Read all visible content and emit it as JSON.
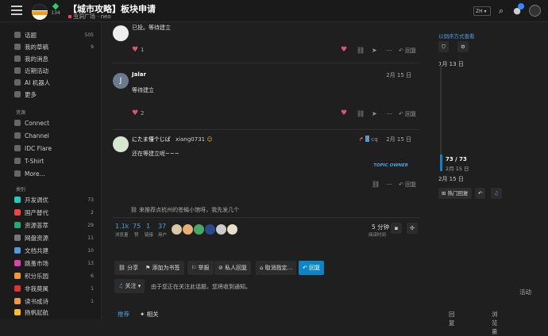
{
  "header": {
    "title": "【城市攻略】板块申请",
    "level": "134",
    "breadcrumb": [
      "虫洞广场",
      "neo"
    ],
    "lang": "ZH"
  },
  "sidebar": {
    "items": [
      {
        "label": "话题",
        "count": "505"
      },
      {
        "label": "我的草稿",
        "count": "9"
      },
      {
        "label": "我的消息",
        "count": ""
      },
      {
        "label": "近期活动",
        "count": ""
      },
      {
        "label": "AI 机器人",
        "count": ""
      },
      {
        "label": "更多",
        "count": ""
      }
    ],
    "resources_head": "资源",
    "resources": [
      "Connect",
      "Channel",
      "IDC Flare",
      "T-Shirt",
      "More..."
    ],
    "categories_head": "类别",
    "categories": [
      {
        "label": "开发调优",
        "count": "73"
      },
      {
        "label": "国产替代",
        "count": "2"
      },
      {
        "label": "资源荟萃",
        "count": "29"
      },
      {
        "label": "网盘资源",
        "count": "11"
      },
      {
        "label": "文档共建",
        "count": "10"
      },
      {
        "label": "跳蚤市场",
        "count": "13"
      },
      {
        "label": "积分乐园",
        "count": "6"
      },
      {
        "label": "非我莫属",
        "count": "1"
      },
      {
        "label": "读书成诗",
        "count": "1"
      },
      {
        "label": "扬帆起航",
        "count": ""
      }
    ]
  },
  "posts": [
    {
      "name": "",
      "date": "",
      "text": "已投。等待建立",
      "likes": "1",
      "reply": "回复"
    },
    {
      "name": "Jalar",
      "date": "2月 15 日",
      "text": "等待建立",
      "likes": "2",
      "reply": "回复",
      "avatar_letter": "J"
    },
    {
      "name": "にたま懂个じば",
      "user": "xiang0731",
      "date": "2月 15 日",
      "text": "还在等建立呢~~~",
      "reply_to": "cq",
      "owner": "TOPIC OWNER",
      "reply": "回复"
    }
  ],
  "recommend": "来推荐点杭州的苍蝇小馆呀，我先发几个",
  "stats": {
    "views": "1.1k",
    "views_label": "浏览量",
    "likes": "75",
    "likes_label": "赞",
    "links": "1",
    "links_label": "链接",
    "users": "37",
    "users_label": "用户",
    "read_time": "5 分钟",
    "read_label": "阅读时间"
  },
  "actions": {
    "share": "分享",
    "bookmark": "添加为书签",
    "flag": "举报",
    "private_reply": "私人回复",
    "cancel": "取消指定...",
    "reply": "回复"
  },
  "watch": {
    "label": "关注",
    "text": "由于您正在关注此话题，您将收到通知。"
  },
  "tabs": {
    "recommend": "推荐",
    "related": "相关",
    "replies": "回复",
    "views": "浏览量",
    "activity": "活动"
  },
  "timeline": {
    "order_link": "以倒序方式查看",
    "start": "1月 13 日",
    "progress": "73 / 73",
    "progress_date": "2月 15 日",
    "end": "2月 15 日",
    "hot": "热门回复"
  }
}
